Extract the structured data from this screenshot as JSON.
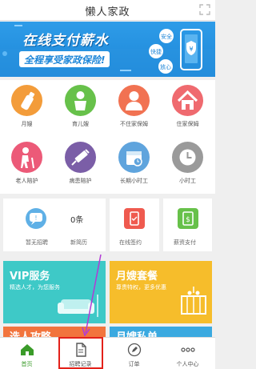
{
  "app": {
    "title": "懒人家政"
  },
  "banner": {
    "headline": "在线支付薪水",
    "subline": "全程享受家政保险!",
    "bubbles": [
      "安全",
      "快捷",
      "放心"
    ],
    "currency_symbol": "¥"
  },
  "services": [
    {
      "label": "月嫂",
      "color": "#f39c3a",
      "icon": "baby-bottle-icon"
    },
    {
      "label": "育儿嫂",
      "color": "#67c14a",
      "icon": "child-icon"
    },
    {
      "label": "不住家保姆",
      "color": "#f17252",
      "icon": "nanny-icon"
    },
    {
      "label": "住家保姆",
      "color": "#ef6a6f",
      "icon": "house-icon"
    },
    {
      "label": "老人陪护",
      "color": "#ec5a78",
      "icon": "elderly-icon"
    },
    {
      "label": "病患陪护",
      "color": "#7b5ea7",
      "icon": "syringe-icon"
    },
    {
      "label": "长期小时工",
      "color": "#5fa4dd",
      "icon": "calendar-icon"
    },
    {
      "label": "小时工",
      "color": "#9a9a9a",
      "icon": "clock-icon"
    }
  ],
  "stats": {
    "recruit_label": "暂无招聘",
    "count_value": "0条",
    "count_label": "新简历",
    "sign_label": "在线签约",
    "pay_label": "薪资支付"
  },
  "features": [
    {
      "title": "VIP服务",
      "subtitle": "精选人才，为您服务",
      "color": "#3ec9c7"
    },
    {
      "title": "月嫂套餐",
      "subtitle": "尊贵特权，更多优惠",
      "color": "#f6bd2b"
    },
    {
      "title": "选人攻略",
      "subtitle": "",
      "color": "#f2743d"
    },
    {
      "title": "月嫂私单",
      "subtitle": "",
      "color": "#3aa9e0"
    }
  ],
  "tabs": [
    {
      "label": "首页",
      "icon": "home-icon"
    },
    {
      "label": "招聘记录",
      "icon": "document-icon"
    },
    {
      "label": "订单",
      "icon": "pen-icon"
    },
    {
      "label": "个人中心",
      "icon": "more-icon"
    }
  ],
  "colors": {
    "accent": "#3a9b29",
    "highlight": "#e3211a",
    "arrow": "#b23ad6"
  }
}
